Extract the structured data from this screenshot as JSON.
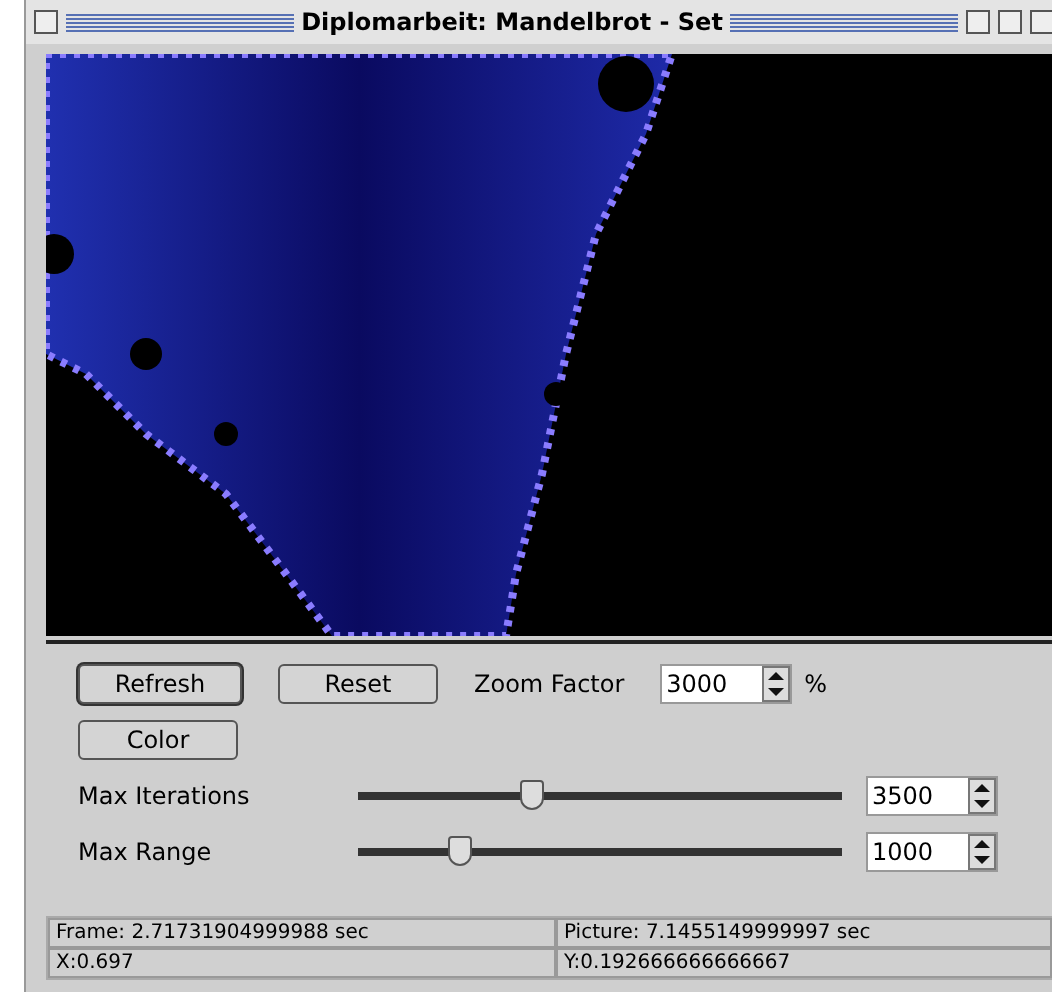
{
  "window": {
    "title": "Diplomarbeit: Mandelbrot - Set"
  },
  "controls": {
    "buttons": [
      {
        "label": "Refresh",
        "default": true
      },
      {
        "label": "Reset",
        "default": false
      }
    ],
    "color_button": "Color",
    "zoom": {
      "label": "Zoom Factor",
      "value": "3000",
      "unit": "%"
    }
  },
  "sliders": [
    {
      "label": "Max Iterations",
      "level": 0.36,
      "value": "3500"
    },
    {
      "label": "Max Range",
      "level": 0.21,
      "value": "1000"
    }
  ],
  "status_bar": [
    [
      "Frame: 2.71731904999988 sec",
      "Picture: 7.1455149999997 sec"
    ],
    [
      "X:0.697",
      "Y:0.192666666666667"
    ]
  ]
}
